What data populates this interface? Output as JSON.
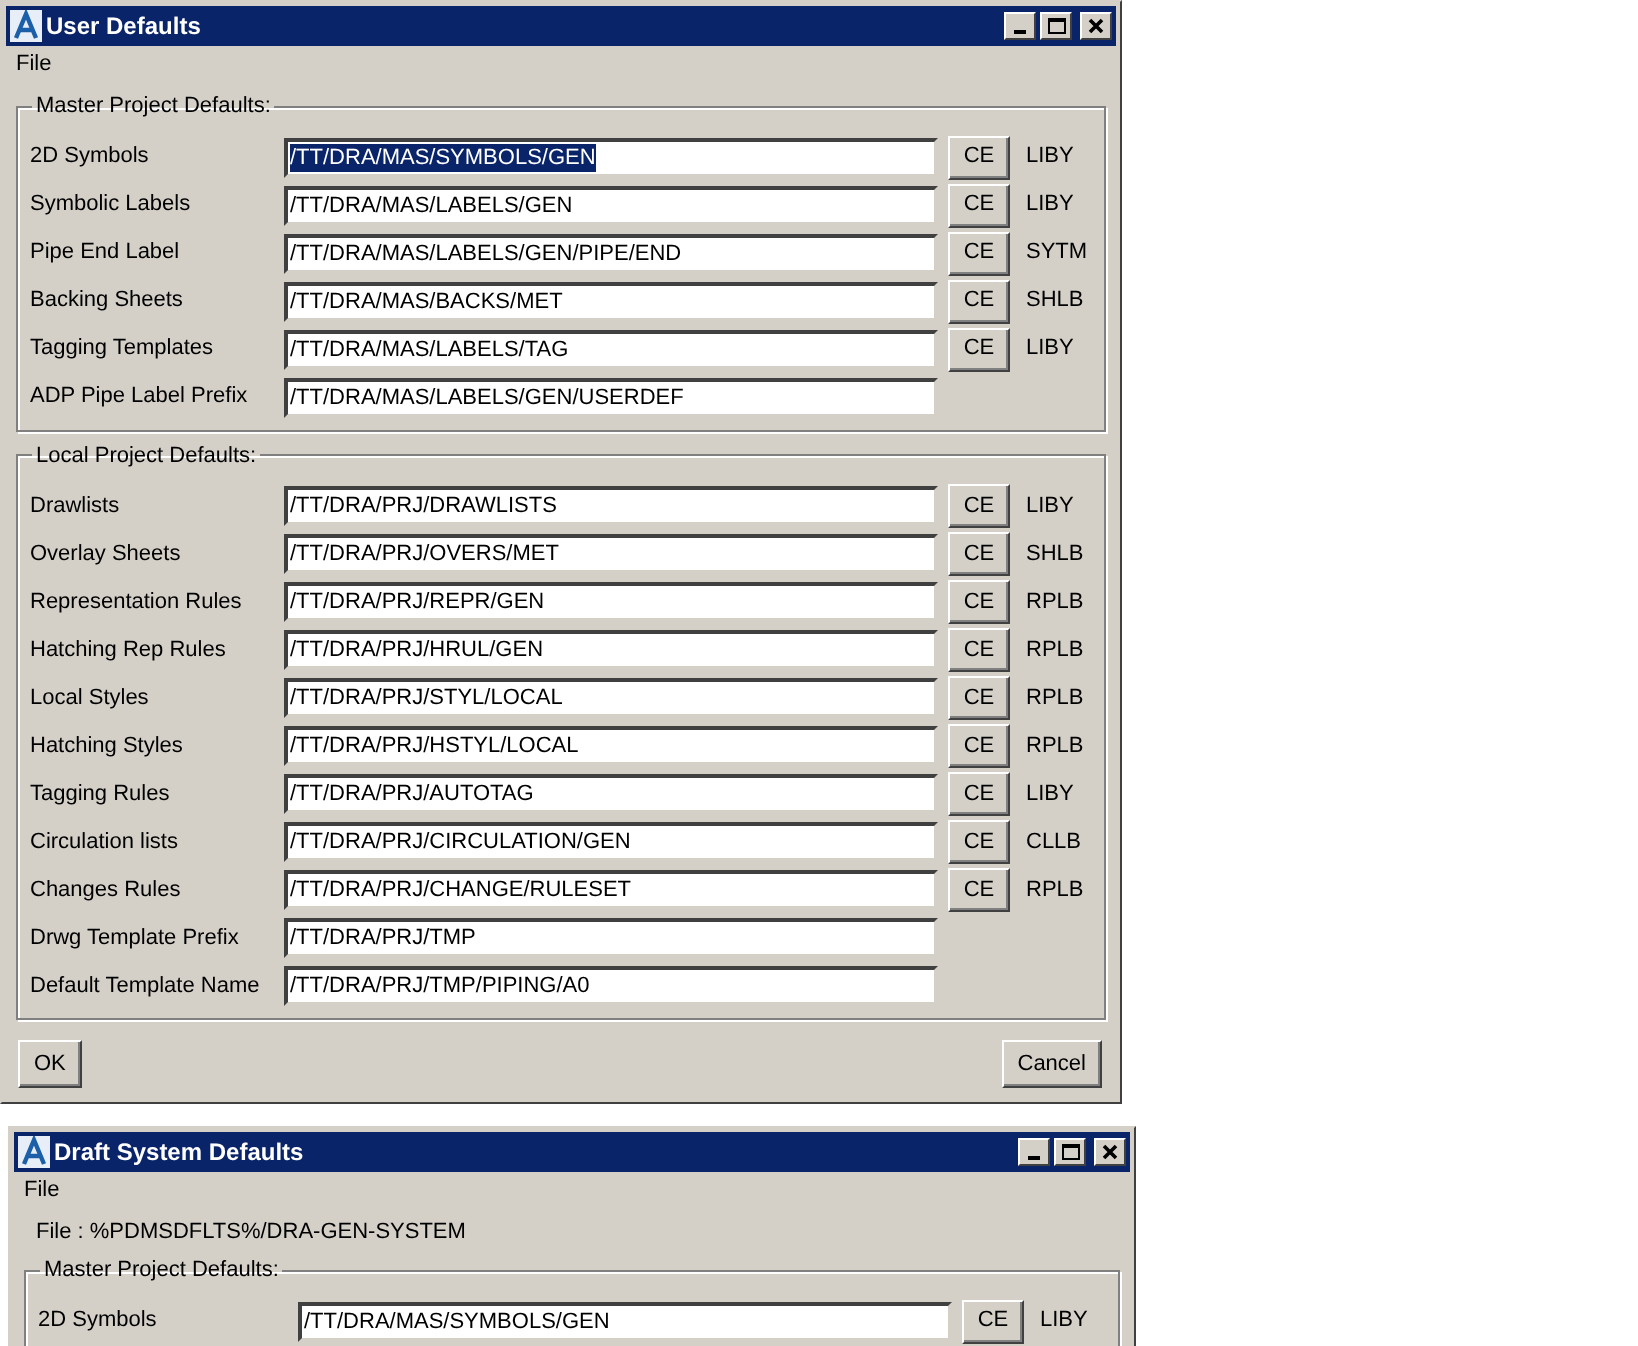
{
  "windows": [
    {
      "title": "User Defaults",
      "menu": [
        "File"
      ],
      "groups": [
        {
          "title": "Master Project Defaults:",
          "rows": [
            {
              "label": "2D Symbols",
              "value": "/TT/DRA/MAS/SYMBOLS/GEN",
              "highlighted": true,
              "kind": "library",
              "button": "CE",
              "type": "LIBY"
            },
            {
              "label": "Symbolic Labels",
              "value": "/TT/DRA/MAS/LABELS/GEN",
              "highlighted": false,
              "kind": "library",
              "button": "CE",
              "type": "LIBY"
            },
            {
              "label": "Pipe End Label",
              "value": "/TT/DRA/MAS/LABELS/GEN/PIPE/END",
              "highlighted": false,
              "kind": "library",
              "button": "CE",
              "type": "SYTM"
            },
            {
              "label": "Backing Sheets",
              "value": "/TT/DRA/MAS/BACKS/MET",
              "highlighted": false,
              "kind": "library",
              "button": "CE",
              "type": "SHLB"
            },
            {
              "label": "Tagging Templates",
              "value": "/TT/DRA/MAS/LABELS/TAG",
              "highlighted": false,
              "kind": "library",
              "button": "CE",
              "type": "LIBY"
            },
            {
              "label": "ADP Pipe Label Prefix",
              "value": "/TT/DRA/MAS/LABELS/GEN/USERDEF",
              "highlighted": false,
              "kind": "plain"
            }
          ]
        },
        {
          "title": "Local Project Defaults:",
          "rows": [
            {
              "label": "Drawlists",
              "value": "/TT/DRA/PRJ/DRAWLISTS",
              "highlighted": false,
              "kind": "library",
              "button": "CE",
              "type": "LIBY"
            },
            {
              "label": "Overlay Sheets",
              "value": "/TT/DRA/PRJ/OVERS/MET",
              "highlighted": false,
              "kind": "library",
              "button": "CE",
              "type": "SHLB"
            },
            {
              "label": "Representation Rules",
              "value": "/TT/DRA/PRJ/REPR/GEN",
              "highlighted": false,
              "kind": "library",
              "button": "CE",
              "type": "RPLB"
            },
            {
              "label": "Hatching Rep Rules",
              "value": "/TT/DRA/PRJ/HRUL/GEN",
              "highlighted": false,
              "kind": "library",
              "button": "CE",
              "type": "RPLB"
            },
            {
              "label": "Local Styles",
              "value": "/TT/DRA/PRJ/STYL/LOCAL",
              "highlighted": false,
              "kind": "library",
              "button": "CE",
              "type": "RPLB"
            },
            {
              "label": "Hatching Styles",
              "value": "/TT/DRA/PRJ/HSTYL/LOCAL",
              "highlighted": false,
              "kind": "library",
              "button": "CE",
              "type": "RPLB"
            },
            {
              "label": "Tagging Rules",
              "value": "/TT/DRA/PRJ/AUTOTAG",
              "highlighted": false,
              "kind": "library",
              "button": "CE",
              "type": "LIBY"
            },
            {
              "label": "Circulation lists",
              "value": "/TT/DRA/PRJ/CIRCULATION/GEN",
              "highlighted": false,
              "kind": "library",
              "button": "CE",
              "type": "CLLB"
            },
            {
              "label": "Changes Rules",
              "value": "/TT/DRA/PRJ/CHANGE/RULESET",
              "highlighted": false,
              "kind": "library",
              "button": "CE",
              "type": "RPLB"
            },
            {
              "label": "Drwg Template Prefix",
              "value": "/TT/DRA/PRJ/TMP",
              "highlighted": false,
              "kind": "plain"
            },
            {
              "label": "Default Template Name",
              "value": "/TT/DRA/PRJ/TMP/PIPING/A0",
              "highlighted": false,
              "kind": "plain"
            }
          ]
        }
      ],
      "buttons": [
        "OK",
        "Cancel"
      ]
    },
    {
      "title": "Draft System Defaults",
      "menu": [
        "File"
      ],
      "file_line": "File : %PDMSDFLTS%/DRA-GEN-SYSTEM",
      "groups": [
        {
          "title": "Master Project Defaults:",
          "rows": [
            {
              "label": "2D Symbols",
              "value": "/TT/DRA/MAS/SYMBOLS/GEN",
              "highlighted": false,
              "kind": "library",
              "button": "CE",
              "type": "LIBY"
            }
          ]
        }
      ]
    }
  ]
}
